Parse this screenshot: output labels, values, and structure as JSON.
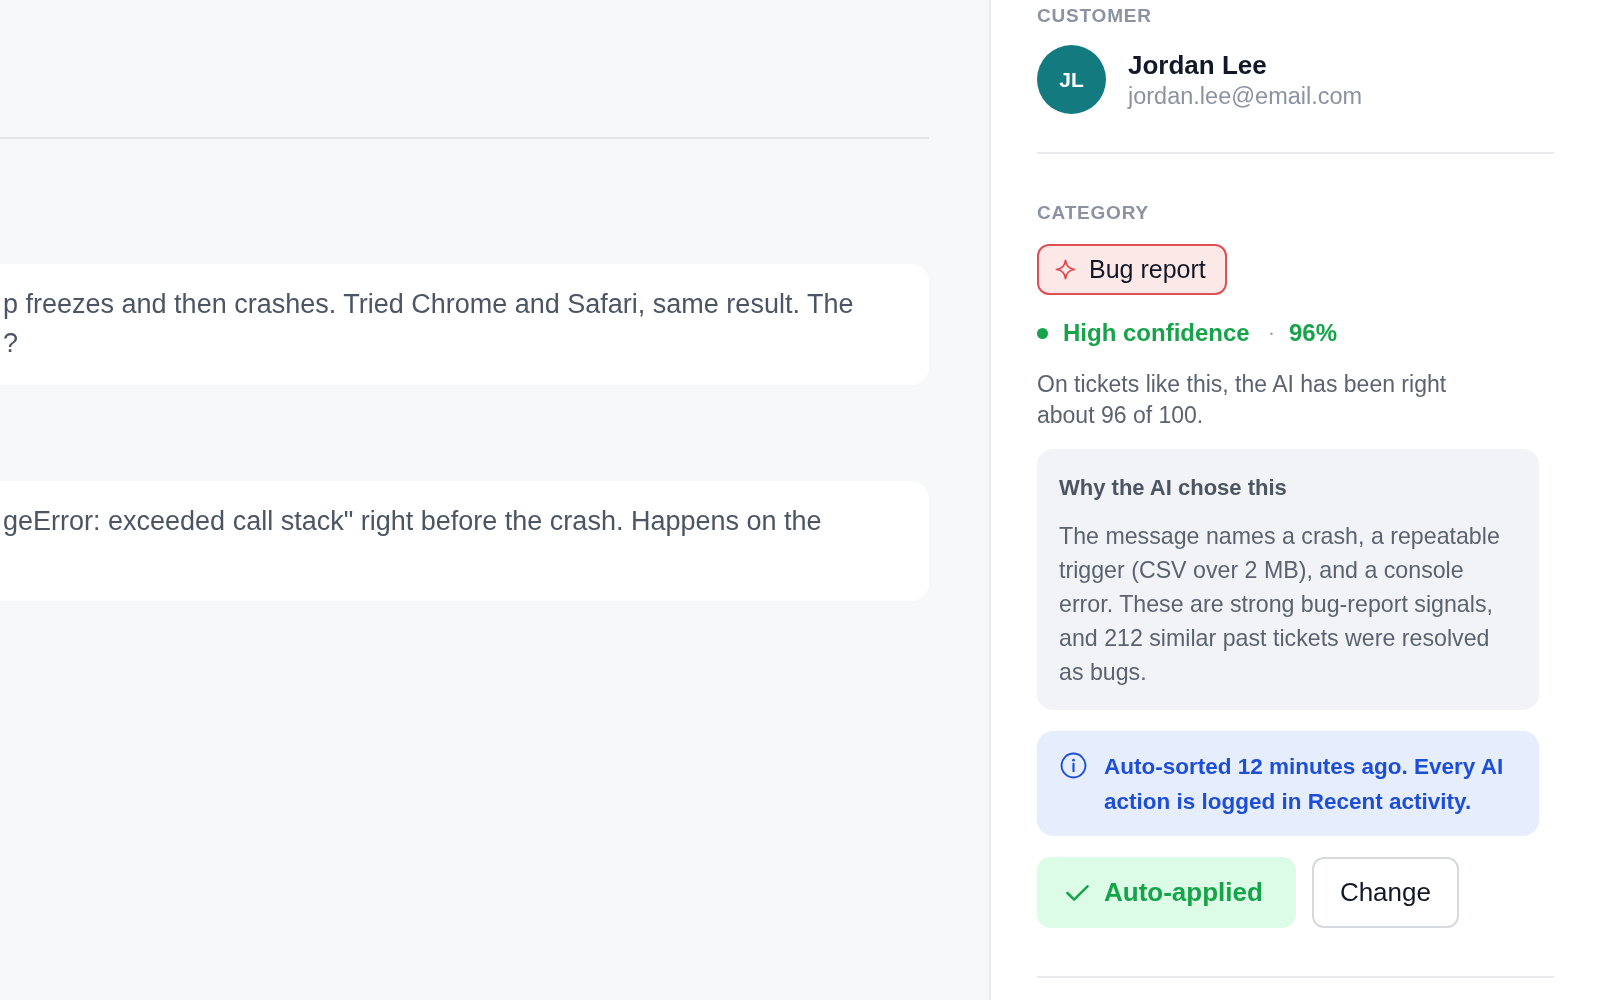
{
  "conversation": {
    "messages": [
      {
        "lines": [
          "p freezes and then crashes. Tried Chrome and Safari, same result. The",
          "?"
        ]
      },
      {
        "lines": [
          "geError: exceeded call stack\" right before the crash. Happens on the"
        ]
      }
    ]
  },
  "details": {
    "customer": {
      "heading": "CUSTOMER",
      "initials": "JL",
      "name": "Jordan Lee",
      "email": "jordan.lee@email.com"
    },
    "category": {
      "heading": "CATEGORY",
      "label": "Bug report",
      "confidence": {
        "label": "High confidence",
        "separator": "·",
        "value": "96%"
      },
      "note": "On tickets like this, the AI has been right about 96 of 100.",
      "reason": {
        "title": "Why the AI chose this",
        "body": "The message names a crash, a repeatable trigger (CSV over 2 MB), and a console error. These are strong bug-report signals, and 212 similar past tickets were resolved as bugs."
      },
      "info": "Auto-sorted 12 minutes ago. Every AI action is logged in Recent activity.",
      "actions": [
        {
          "kind": "status",
          "label": "Auto-applied"
        },
        {
          "kind": "button",
          "label": "Change"
        }
      ]
    }
  }
}
